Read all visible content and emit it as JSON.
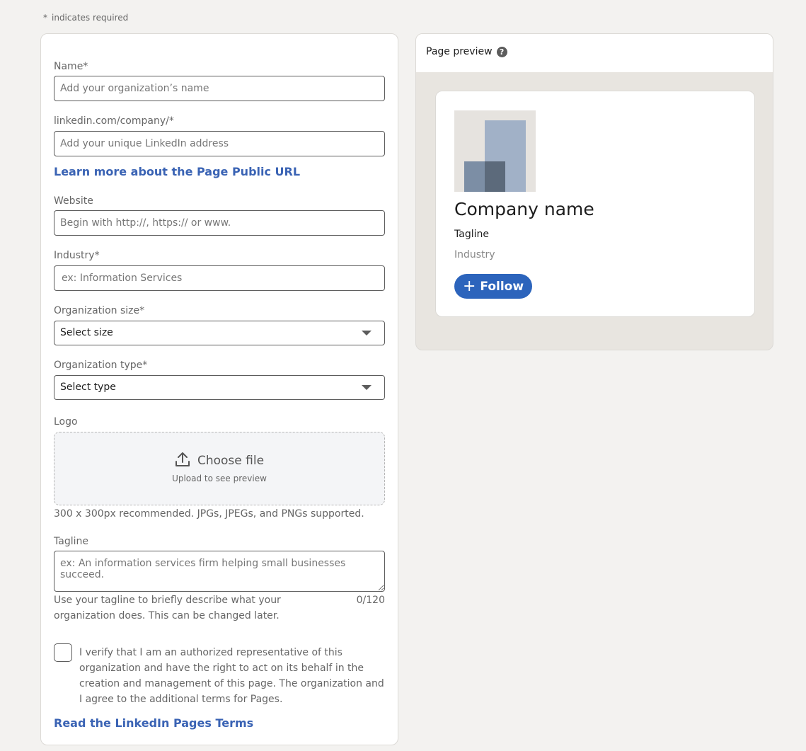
{
  "required_note": {
    "star": "*",
    "text": "indicates required"
  },
  "form": {
    "name": {
      "label": "Name*",
      "placeholder": "Add your organization’s name",
      "value": ""
    },
    "url": {
      "label": "linkedin.com/company/*",
      "placeholder": "Add your unique LinkedIn address",
      "value": ""
    },
    "url_link": "Learn more about the Page Public URL",
    "website": {
      "label": "Website",
      "placeholder": "Begin with http://, https:// or www.",
      "value": ""
    },
    "industry": {
      "label": "Industry*",
      "placeholder": "ex: Information Services",
      "value": ""
    },
    "org_size": {
      "label": "Organization size*",
      "selected": "Select size"
    },
    "org_type": {
      "label": "Organization type*",
      "selected": "Select type"
    },
    "logo": {
      "label": "Logo",
      "choose_label": "Choose file",
      "sub_label": "Upload to see preview",
      "hint": "300 x 300px recommended. JPGs, JPEGs, and PNGs supported."
    },
    "tagline": {
      "label": "Tagline",
      "placeholder": "ex: An information services firm helping small businesses succeed.",
      "value": "",
      "hint": "Use your tagline to briefly describe what your organization does. This can be changed later.",
      "counter": "0/120"
    },
    "verify": {
      "checked": false,
      "text": "I verify that I am an authorized representative of this organization and have the right to act on its behalf in the creation and management of this page. The organization and I agree to the additional terms for Pages."
    },
    "terms_link": "Read the LinkedIn Pages Terms"
  },
  "preview": {
    "title": "Page preview",
    "help_icon": "?",
    "company_name": "Company name",
    "tagline": "Tagline",
    "industry": "Industry",
    "follow_label": "Follow",
    "follow_icon": "+"
  },
  "colors": {
    "accent_link": "#3a63b4",
    "follow_button": "#2c64bc",
    "page_background": "#f3f2f0"
  }
}
